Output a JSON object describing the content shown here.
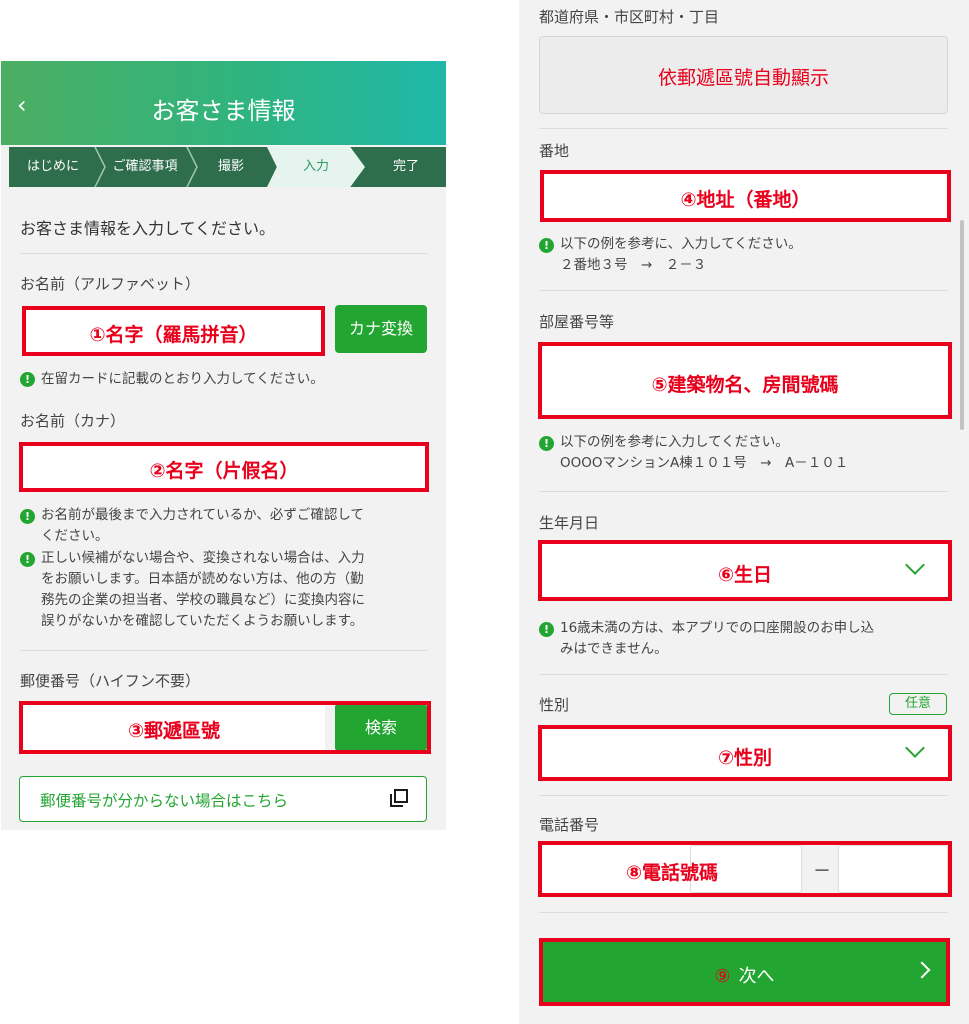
{
  "left": {
    "header": {
      "back": "‹",
      "title": "お客さま情報"
    },
    "steps": [
      "はじめに",
      "ご確認事項",
      "撮影",
      "入力",
      "完了"
    ],
    "intro": "お客さま情報を入力してください。",
    "name_alpha": {
      "label": "お名前（アルファベット）",
      "annotation": "①名字（羅馬拼音）",
      "button": "カナ変換",
      "note": "在留カードに記載のとおり入力してください。"
    },
    "name_kana": {
      "label": "お名前（カナ）",
      "annotation": "②名字（片假名）",
      "note1_line1": "お名前が最後まで入力されているか、必ずご確認して",
      "note1_line2": "ください。",
      "note2_line1": "正しい候補がない場合や、変換されない場合は、入力",
      "note2_line2": "をお願いします。日本語が読めない方は、他の方（勤",
      "note2_line3": "務先の企業の担当者、学校の職員など）に変換内容に",
      "note2_line4": "誤りがないかを確認していただくようお願いします。"
    },
    "postal": {
      "label": "郵便番号（ハイフン不要）",
      "annotation": "③郵遞區號",
      "button": "検索",
      "link": "郵便番号が分からない場合はこちら"
    }
  },
  "right": {
    "prefecture": {
      "label": "都道府県・市区町村・丁目",
      "annotation": "依郵遞區號自動顯示"
    },
    "banchi": {
      "label": "番地",
      "annotation": "④地址（番地）",
      "note_line1": "以下の例を参考に、入力してください。",
      "note_line2": "２番地３号　→　２－３"
    },
    "room": {
      "label": "部屋番号等",
      "annotation": "⑤建築物名、房間號碼",
      "note_line1": "以下の例を参考に入力してください。",
      "note_line2": "OOOOマンションA棟１０１号　→　A－１０１"
    },
    "birth": {
      "label": "生年月日",
      "annotation": "⑥生日",
      "note_line1": "16歳未満の方は、本アプリでの口座開設のお申し込",
      "note_line2": "みはできません。"
    },
    "gender": {
      "label": "性別",
      "badge": "任意",
      "annotation": "⑦性別"
    },
    "phone": {
      "label": "電話番号",
      "annotation": "⑧電話號碼",
      "dash": "－"
    },
    "next": {
      "num": "⑨",
      "label": "次へ"
    }
  },
  "colors": {
    "accent_green": "#23a531",
    "annotation_red": "#e8001c",
    "step_bar": "#2e6e4c"
  },
  "icons": {
    "note": "exclamation-circle-icon",
    "link": "external-window-icon",
    "select": "chevron-down-icon"
  }
}
